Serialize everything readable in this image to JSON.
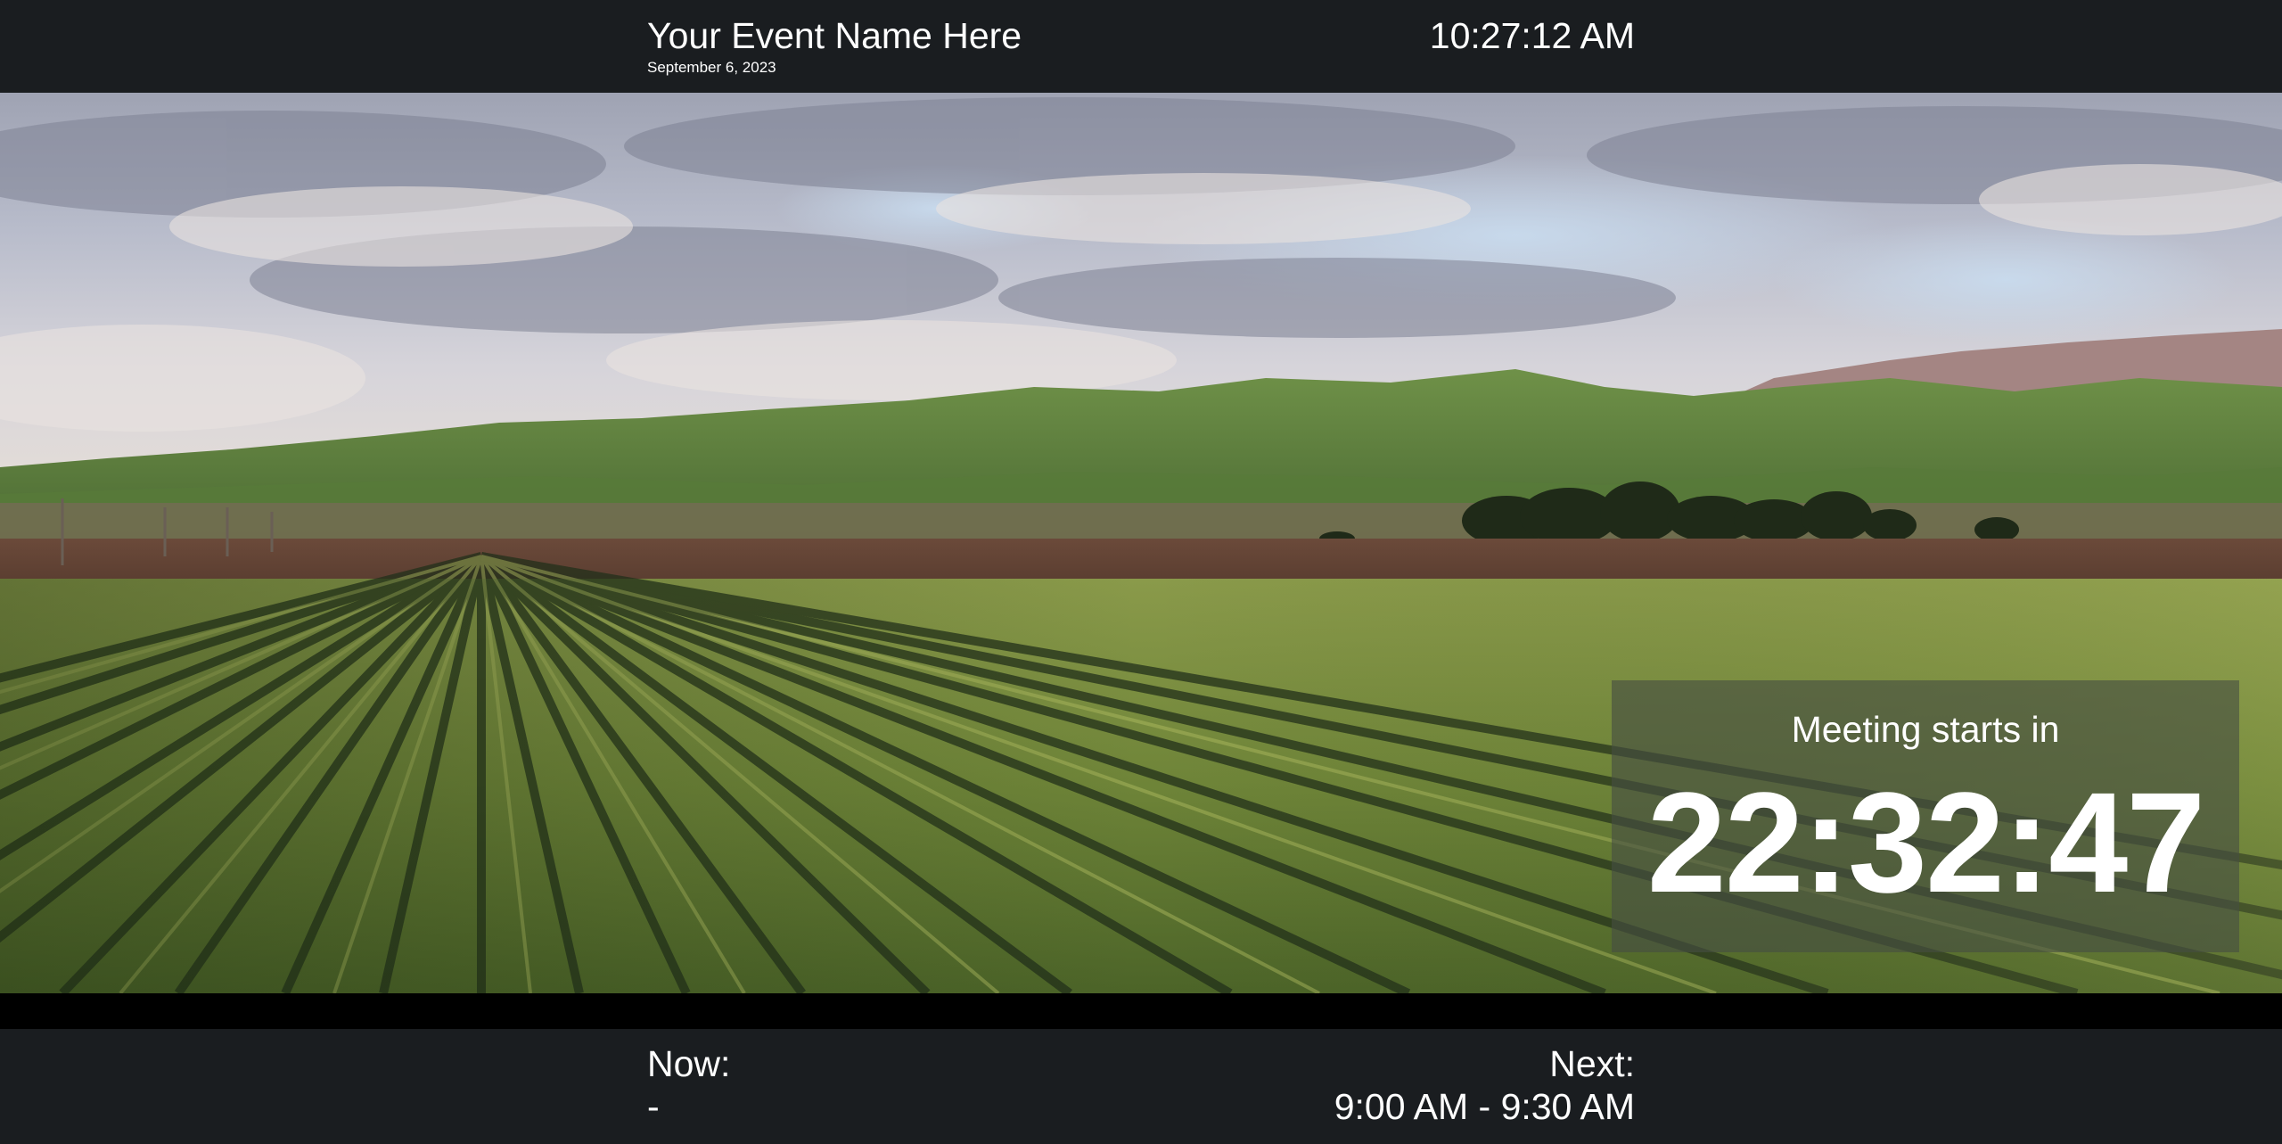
{
  "header": {
    "event_name": "Your Event Name Here",
    "date": "September 6, 2023",
    "clock": "10:27:12 AM"
  },
  "hero": {
    "image": "farm-field-landscape-image"
  },
  "countdown": {
    "label": "Meeting starts in",
    "value": "22:32:47"
  },
  "footer": {
    "now_label": "Now:",
    "now_value": "-",
    "next_label": "Next:",
    "next_value": "9:00 AM - 9:30 AM"
  },
  "colors": {
    "bar_background": "#1a1d20",
    "countdown_overlay": "rgba(70,78,66,0.62)",
    "text": "#ffffff"
  }
}
